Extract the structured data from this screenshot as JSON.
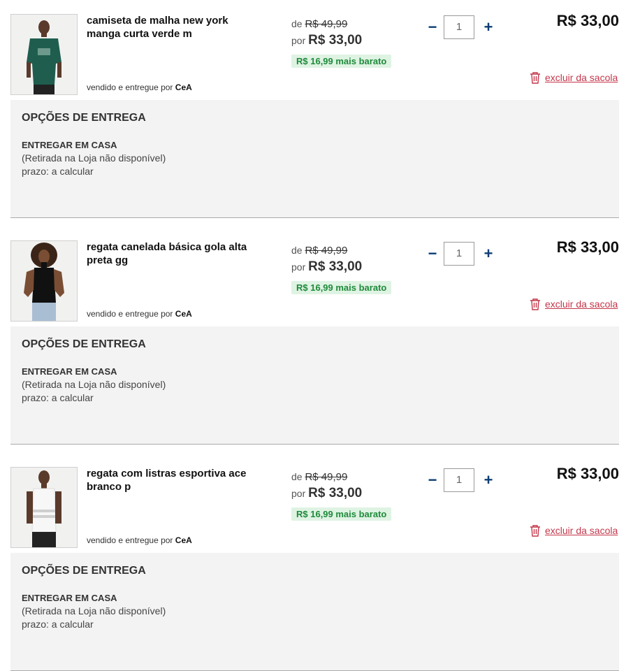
{
  "labels": {
    "de": "de",
    "por": "por",
    "seller_prefix": "vendido e entregue por",
    "remove": "excluir da sacola",
    "delivery_title": "OPÇÕES DE ENTREGA",
    "delivery_option": "ENTREGAR EM CASA",
    "delivery_note": "(Retirada na Loja não disponível)",
    "delivery_term": "prazo: a calcular"
  },
  "icons": {
    "minus": "−",
    "plus": "+",
    "trash": "trash-icon"
  },
  "colors": {
    "accent": "#0c3d73",
    "remove": "#c4364a",
    "badge_bg": "#dff3e3",
    "badge_text": "#1e8a3a"
  },
  "items": [
    {
      "name": "camiseta de malha new york manga curta verde m",
      "seller": "CeA",
      "old_price": "R$ 49,99",
      "new_price": "R$ 33,00",
      "savings": "R$ 16,99 mais barato",
      "quantity": "1",
      "total": "R$ 33,00"
    },
    {
      "name": "regata canelada básica gola alta preta gg",
      "seller": "CeA",
      "old_price": "R$ 49,99",
      "new_price": "R$ 33,00",
      "savings": "R$ 16,99 mais barato",
      "quantity": "1",
      "total": "R$ 33,00"
    },
    {
      "name": "regata com listras esportiva ace branco p",
      "seller": "CeA",
      "old_price": "R$ 49,99",
      "new_price": "R$ 33,00",
      "savings": "R$ 16,99 mais barato",
      "quantity": "1",
      "total": "R$ 33,00"
    }
  ]
}
